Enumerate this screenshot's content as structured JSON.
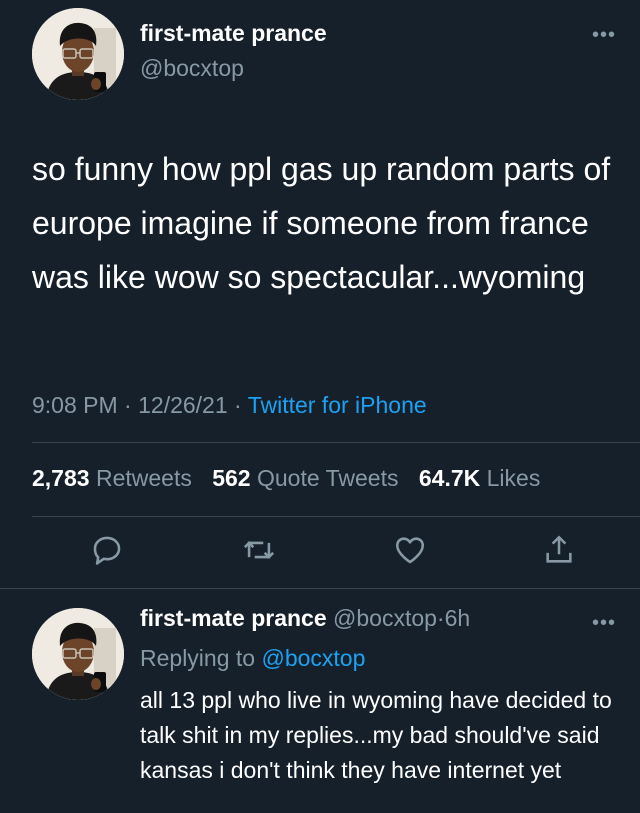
{
  "tweet": {
    "display_name": "first-mate prance",
    "handle": "@bocxtop",
    "more_icon": "more-dots-icon",
    "text": "so funny how ppl gas up random parts of europe imagine if someone from france was like wow so spectacular...wyoming",
    "time": "9:08 PM",
    "date": "12/26/21",
    "separator": "·",
    "source": "Twitter for iPhone",
    "stats": {
      "retweets_count": "2,783",
      "retweets_label": "Retweets",
      "quotes_count": "562",
      "quotes_label": "Quote Tweets",
      "likes_count": "64.7K",
      "likes_label": "Likes"
    },
    "actions": [
      "reply-icon",
      "retweet-icon",
      "like-icon",
      "share-icon"
    ]
  },
  "reply": {
    "display_name": "first-mate prance",
    "handle": "@bocxtop",
    "age": "6h",
    "separator": "·",
    "replying_label": "Replying to",
    "replying_handle": "@bocxtop",
    "text": "all 13 ppl who live in wyoming have decided to talk shit in my replies...my bad should've said kansas i don't think they have internet yet"
  },
  "colors": {
    "background": "#15202b",
    "muted": "#8899a6",
    "accent": "#1da1f2",
    "divider": "#38444d"
  }
}
